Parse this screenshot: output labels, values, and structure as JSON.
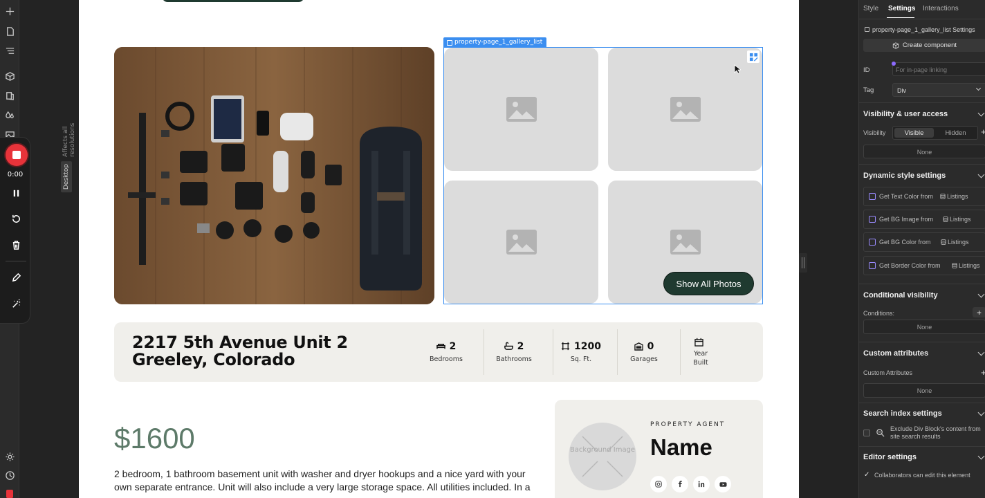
{
  "recorder": {
    "time": "0:00"
  },
  "canvas": {
    "affects_label": "Affects all resolutions",
    "breakpoint_label": "Desktop"
  },
  "gallery": {
    "tag_label": "property-page_1_gallery_list",
    "button_label": "Show All Photos"
  },
  "listing": {
    "address": "2217 5th Avenue Unit 2 Greeley, Colorado",
    "stats": [
      {
        "value": "2",
        "label": "Bedrooms",
        "icon": "bed-icon"
      },
      {
        "value": "2",
        "label": "Bathrooms",
        "icon": "bath-icon"
      },
      {
        "value": "1200",
        "label": "Sq. Ft.",
        "icon": "area-icon"
      },
      {
        "value": "0",
        "label": "Garages",
        "icon": "garage-icon"
      },
      {
        "value": "",
        "label": "Year Built",
        "icon": "calendar-icon"
      }
    ],
    "price": "$1600",
    "description": "2 bedroom, 1 bathroom basement unit with washer and dryer hookups and a nice yard with your own separate entrance.  Unit will also include a very large storage space. All utilities included. In a"
  },
  "agent": {
    "kicker": "PROPERTY AGENT",
    "name": "Name",
    "avatar_text": "Background Image",
    "socials": [
      "instagram-icon",
      "facebook-icon",
      "linkedin-icon",
      "youtube-icon"
    ]
  },
  "panel": {
    "tabs": [
      "Style",
      "Settings",
      "Interactions"
    ],
    "element_title": "property-page_1_gallery_list Settings",
    "create_component": "Create component",
    "id_label": "ID",
    "id_placeholder": "For in-page linking",
    "tag_label": "Tag",
    "tag_value": "Div",
    "visibility_heading": "Visibility & user access",
    "visibility_label": "Visibility",
    "visible_option": "Visible",
    "hidden_option": "Hidden",
    "visibility_none": "None",
    "dynamic_heading": "Dynamic style settings",
    "dynamic_rows": [
      {
        "label": "Get Text Color from",
        "source": "Listings"
      },
      {
        "label": "Get BG Image from",
        "source": "Listings"
      },
      {
        "label": "Get BG Color from",
        "source": "Listings"
      },
      {
        "label": "Get Border Color from",
        "source": "Listings"
      }
    ],
    "conditional_heading": "Conditional visibility",
    "conditions_label": "Conditions:",
    "conditions_none": "None",
    "custom_attr_heading": "Custom attributes",
    "custom_attr_label": "Custom Attributes",
    "custom_attr_none": "None",
    "search_heading": "Search index settings",
    "search_exclude": "Exclude Div Block's content from site search results",
    "editor_heading": "Editor settings",
    "editor_collab": "Collaborators can edit this element"
  },
  "colors": {
    "accent": "#3b8ef0",
    "brand_green": "#1f3a30",
    "price_green": "#5d7a69",
    "record_red": "#e8333a"
  }
}
